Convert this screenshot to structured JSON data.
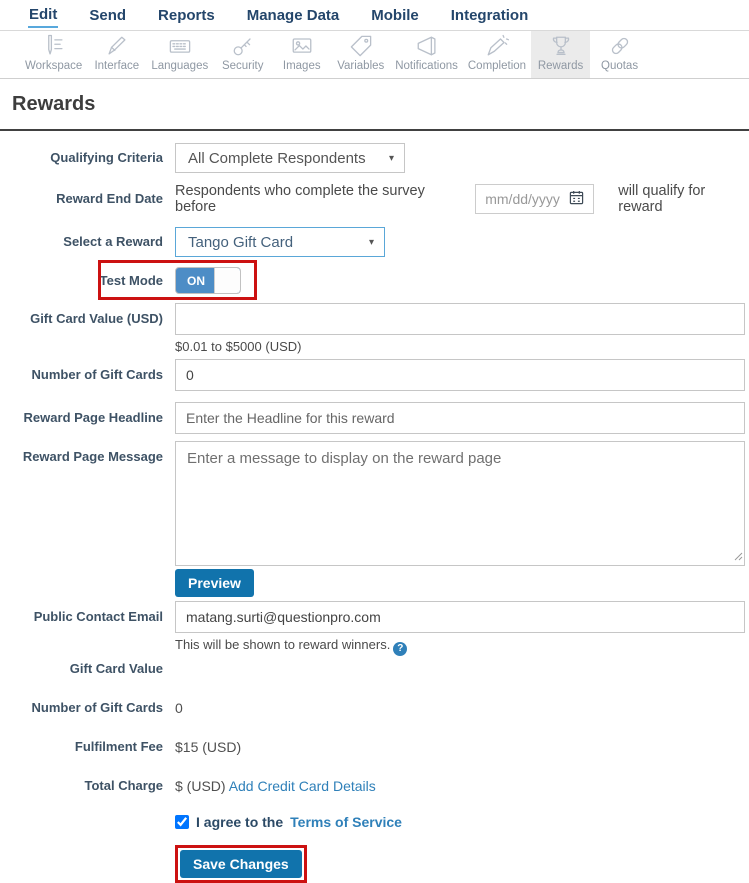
{
  "topnav": {
    "items": [
      {
        "label": "Edit",
        "active": true
      },
      {
        "label": "Send",
        "active": false
      },
      {
        "label": "Reports",
        "active": false
      },
      {
        "label": "Manage Data",
        "active": false
      },
      {
        "label": "Mobile",
        "active": false
      },
      {
        "label": "Integration",
        "active": false
      }
    ]
  },
  "toolbar": {
    "selected": "Rewards",
    "items": [
      {
        "label": "Workspace",
        "icon": "workspace-icon"
      },
      {
        "label": "Interface",
        "icon": "interface-icon"
      },
      {
        "label": "Languages",
        "icon": "languages-icon"
      },
      {
        "label": "Security",
        "icon": "security-icon"
      },
      {
        "label": "Images",
        "icon": "images-icon"
      },
      {
        "label": "Variables",
        "icon": "variables-icon"
      },
      {
        "label": "Notifications",
        "icon": "notifications-icon"
      },
      {
        "label": "Completion",
        "icon": "completion-icon"
      },
      {
        "label": "Rewards",
        "icon": "rewards-icon"
      },
      {
        "label": "Quotas",
        "icon": "quotas-icon"
      }
    ]
  },
  "page": {
    "title": "Rewards"
  },
  "form": {
    "qualifying_criteria": {
      "label": "Qualifying Criteria",
      "value": "All Complete Respondents"
    },
    "reward_end_date": {
      "label": "Reward End Date",
      "before_text": "Respondents who complete the survey before",
      "placeholder": "mm/dd/yyyy",
      "after_text": "will qualify for reward"
    },
    "select_reward": {
      "label": "Select a Reward",
      "value": "Tango Gift Card"
    },
    "test_mode": {
      "label": "Test Mode",
      "state": "ON"
    },
    "gift_card_value": {
      "label": "Gift Card Value (USD)",
      "value": "",
      "helper": "$0.01 to $5000 (USD)"
    },
    "number_of_gift_cards": {
      "label": "Number of Gift Cards",
      "value": "0"
    },
    "reward_page_headline": {
      "label": "Reward Page Headline",
      "placeholder": "Enter the Headline for this reward"
    },
    "reward_page_message": {
      "label": "Reward Page Message",
      "placeholder": "Enter a message to display on the reward page"
    },
    "preview_button": "Preview",
    "public_contact_email": {
      "label": "Public Contact Email",
      "value": "matang.surti@questionpro.com",
      "helper": "This will be shown to reward winners."
    },
    "summary": {
      "gift_card_value": {
        "label": "Gift Card Value",
        "value": ""
      },
      "number_of_gift_cards": {
        "label": "Number of Gift Cards",
        "value": "0"
      },
      "fulfilment_fee": {
        "label": "Fulfilment Fee",
        "value": "$15 (USD)"
      },
      "total_charge": {
        "label": "Total Charge",
        "value": "$ (USD)",
        "link": "Add Credit Card Details"
      }
    },
    "agreement": {
      "text": "I agree to the",
      "link": "Terms of Service",
      "checked": true
    },
    "save_button": "Save Changes"
  },
  "icons": {
    "caret": "▾",
    "help": "?"
  },
  "colors": {
    "nav_navy": "#24466b",
    "accent_blue": "#1173ac",
    "link_blue": "#2f80b9",
    "toggle_blue": "#4d8dc6",
    "focus_border_blue": "#5aa7d8",
    "annotation_red": "#cc1111",
    "selected_tab_bg": "#ebebeb",
    "icon_gray": "#b9c0ca"
  }
}
